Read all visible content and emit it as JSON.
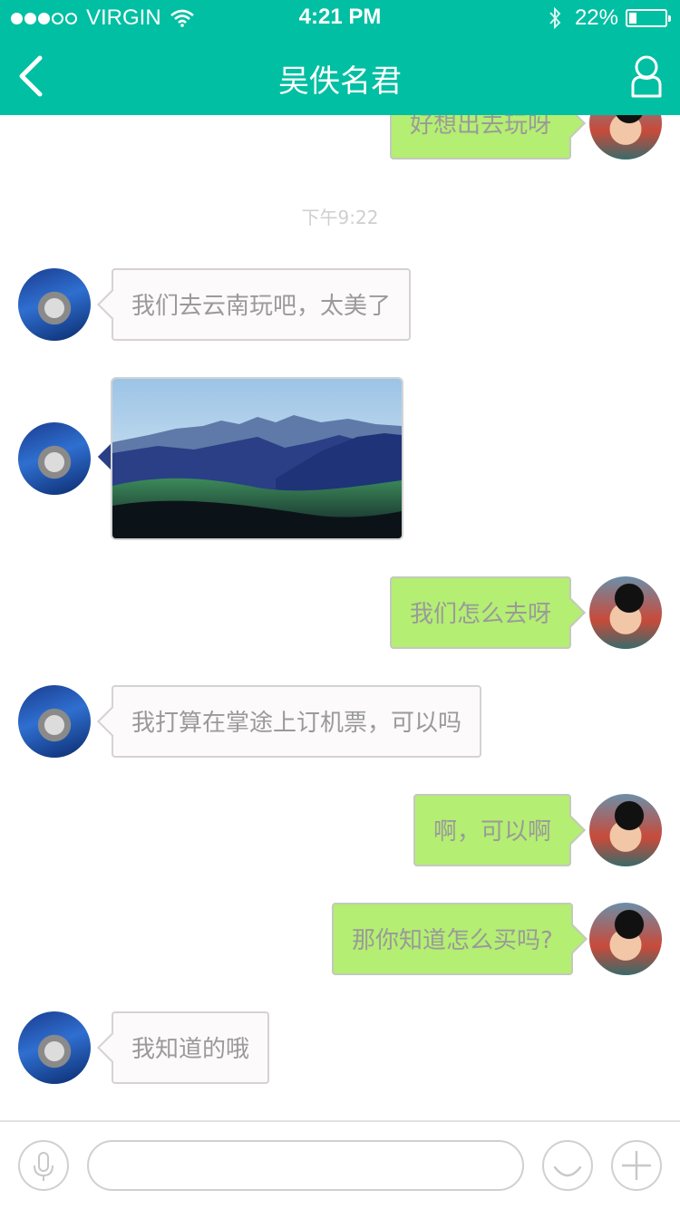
{
  "status_bar": {
    "signal_bars_filled": 3,
    "signal_bars_total": 5,
    "carrier": "VIRGIN",
    "time": "4:21 PM",
    "battery_percent": "22%",
    "battery_level": 0.22
  },
  "nav": {
    "title": "吴佚名君",
    "back_icon": "chevron-left-icon",
    "profile_icon": "person-icon"
  },
  "colors": {
    "header_bg": "#00bfa2",
    "outgoing_bubble": "#b4ee72",
    "incoming_bubble": "#fcfafa",
    "text": "#9a9a9a"
  },
  "messages": [
    {
      "sender": "self",
      "text": "好想出去玩呀"
    },
    {
      "timestamp": "下午9:22"
    },
    {
      "sender": "friend",
      "text": "我们去云南玩吧，太美了"
    },
    {
      "sender": "friend",
      "type": "image",
      "image": "mountain-landscape-photo"
    },
    {
      "sender": "self",
      "text": "我们怎么去呀"
    },
    {
      "sender": "friend",
      "text": "我打算在掌途上订机票，可以吗"
    },
    {
      "sender": "self",
      "text": "啊，可以啊"
    },
    {
      "sender": "self",
      "text": "那你知道怎么买吗?"
    },
    {
      "sender": "friend",
      "text": "我知道的哦"
    }
  ],
  "input_bar": {
    "voice_icon": "microphone-icon",
    "text_value": "",
    "emoji_icon": "smiley-icon",
    "add_icon": "plus-icon"
  }
}
